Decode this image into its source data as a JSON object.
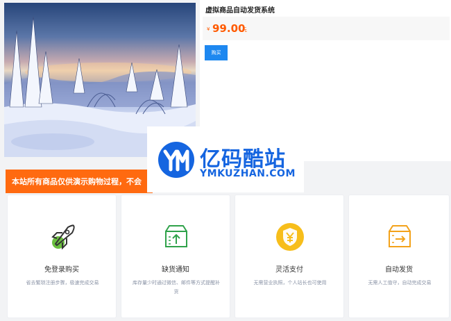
{
  "product": {
    "title": "虚拟商品自动发货系统",
    "price_currency": "¥",
    "price_amount": "99.00",
    "price_unit": "元",
    "buy_label": "购买"
  },
  "notice": {
    "text": "本站所有商品仅供演示购物过程，不会"
  },
  "watermark": {
    "title": "亿码酷站",
    "subtitle": "YMKUZHAN.COM",
    "color": "#1565e0"
  },
  "features": [
    {
      "icon": "rocket-icon",
      "title": "免登录购买",
      "desc": "省去繁琐注册步骤，极速完成交易"
    },
    {
      "icon": "box-upload-icon",
      "title": "缺货通知",
      "desc": "库存量少时通过微信、邮件等方式提醒补货"
    },
    {
      "icon": "yen-shield-icon",
      "title": "灵活支付",
      "desc": "无需营业执照，个人站长也可使用"
    },
    {
      "icon": "box-delivery-icon",
      "title": "自动发货",
      "desc": "无需人工值守，自动完成交易"
    }
  ],
  "colors": {
    "accent": "#1e88f0",
    "price": "#ff5a00",
    "notice_bg": "#ff6a10"
  }
}
